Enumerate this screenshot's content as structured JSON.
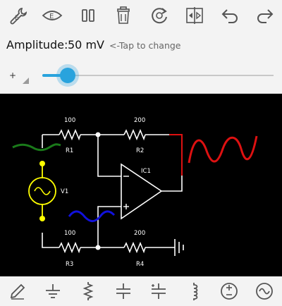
{
  "toolbar": {
    "items": [
      {
        "name": "wrench-e-icon",
        "glyph": "E"
      },
      {
        "name": "eye-e-icon",
        "glyph": "E"
      },
      {
        "name": "pause-icon"
      },
      {
        "name": "trash-icon"
      },
      {
        "name": "reset-icon"
      },
      {
        "name": "flip-icon"
      },
      {
        "name": "undo-icon"
      },
      {
        "name": "redo-icon"
      }
    ]
  },
  "amplitude": {
    "label": "Amplitude:",
    "value": "50 mV",
    "hint": "<-Tap to change",
    "spinner_symbol": "+",
    "slider_fraction": 0.11,
    "accent": "#29a3dd"
  },
  "circuit": {
    "r1": {
      "name": "R1",
      "value": "100"
    },
    "r2": {
      "name": "R2",
      "value": "200"
    },
    "r3": {
      "name": "R3",
      "value": "100"
    },
    "r4": {
      "name": "R4",
      "value": "200"
    },
    "ic": {
      "name": "IC1"
    },
    "source": {
      "name": "V1"
    },
    "colors": {
      "wire": "#ffffff",
      "source": "#ffff00",
      "input_wave": "#1a7a1a",
      "output_wave": "#dd1111",
      "plus_wave": "#1111dd"
    }
  },
  "bottombar": {
    "items": [
      {
        "name": "pencil-icon"
      },
      {
        "name": "ground-icon"
      },
      {
        "name": "resistor-icon"
      },
      {
        "name": "capacitor-icon"
      },
      {
        "name": "polar-capacitor-icon"
      },
      {
        "name": "inductor-icon"
      },
      {
        "name": "dc-source-icon"
      },
      {
        "name": "ac-source-icon"
      }
    ]
  }
}
